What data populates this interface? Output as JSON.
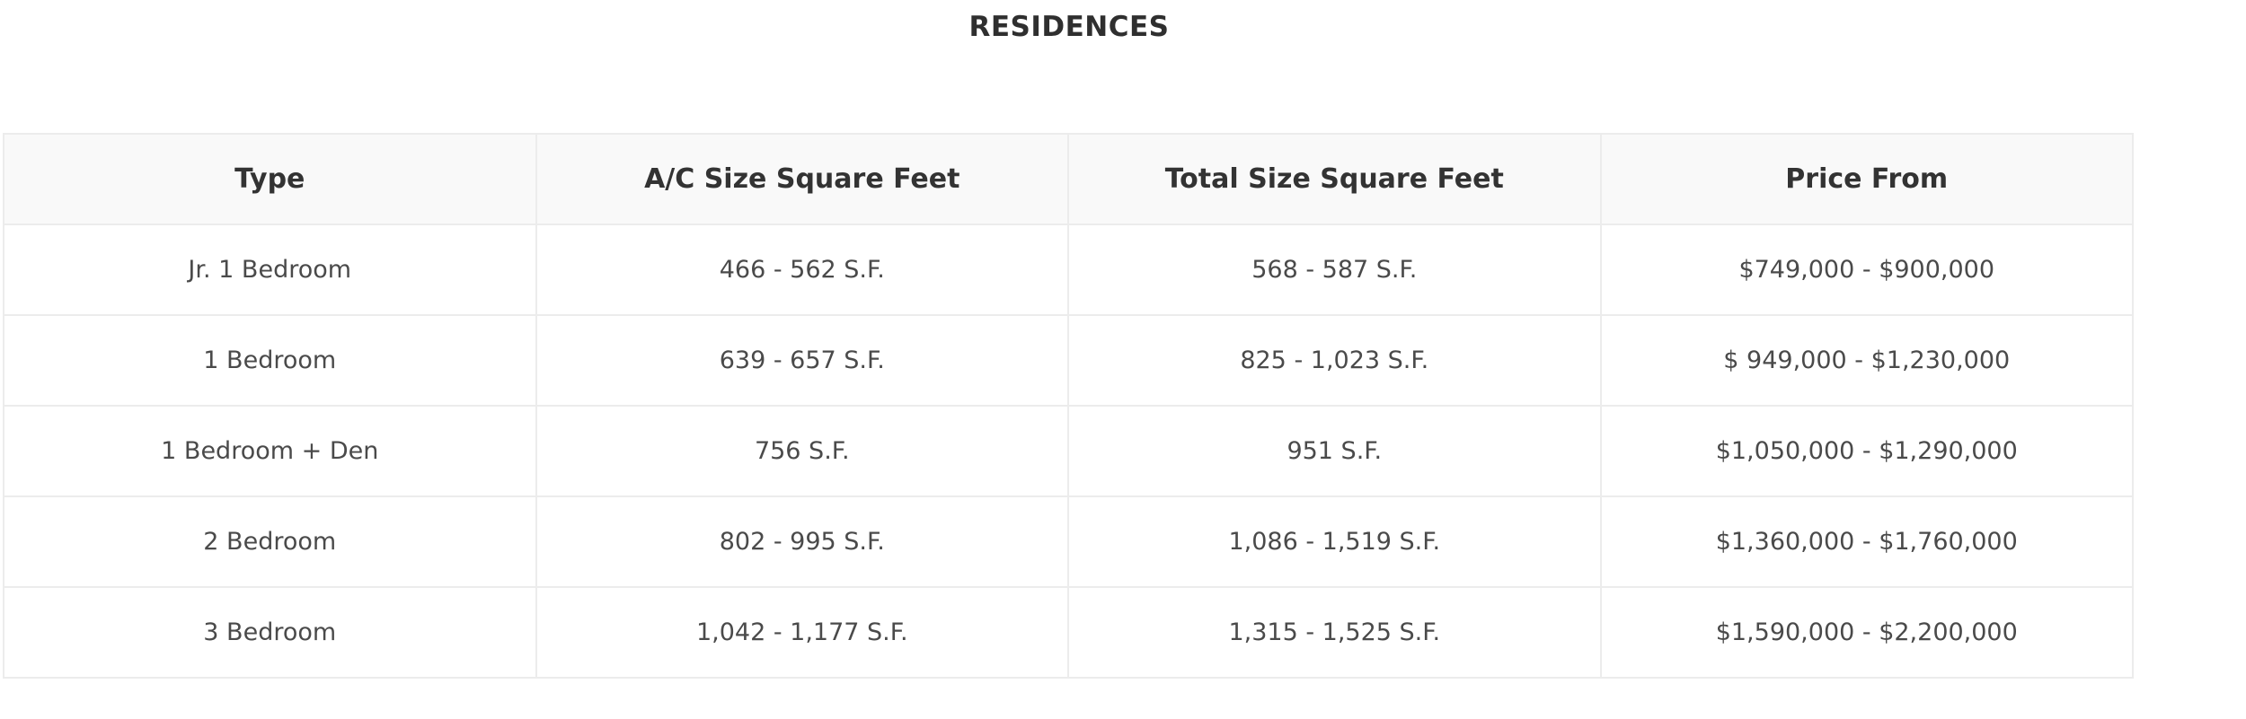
{
  "page": {
    "title": "RESIDENCES"
  },
  "table": {
    "headers": [
      "Type",
      "A/C Size Square Feet",
      "Total Size Square Feet",
      "Price From"
    ],
    "rows": [
      [
        "Jr. 1 Bedroom",
        "466 - 562 S.F.",
        "568 - 587 S.F.",
        "$749,000 - $900,000"
      ],
      [
        "1 Bedroom",
        "639 - 657 S.F.",
        "825 - 1,023 S.F.",
        "$ 949,000 - $1,230,000"
      ],
      [
        "1 Bedroom + Den",
        "756 S.F.",
        "951 S.F.",
        "$1,050,000 - $1,290,000"
      ],
      [
        "2 Bedroom",
        "802 - 995 S.F.",
        "1,086 - 1,519 S.F.",
        "$1,360,000 - $1,760,000"
      ],
      [
        "3 Bedroom",
        "1,042 - 1,177 S.F.",
        "1,315 - 1,525 S.F.",
        "$1,590,000 - $2,200,000"
      ]
    ]
  },
  "colors": {
    "border": "#ececec",
    "header_bg": "#f9f9f9",
    "text": "#4a4a4a"
  }
}
